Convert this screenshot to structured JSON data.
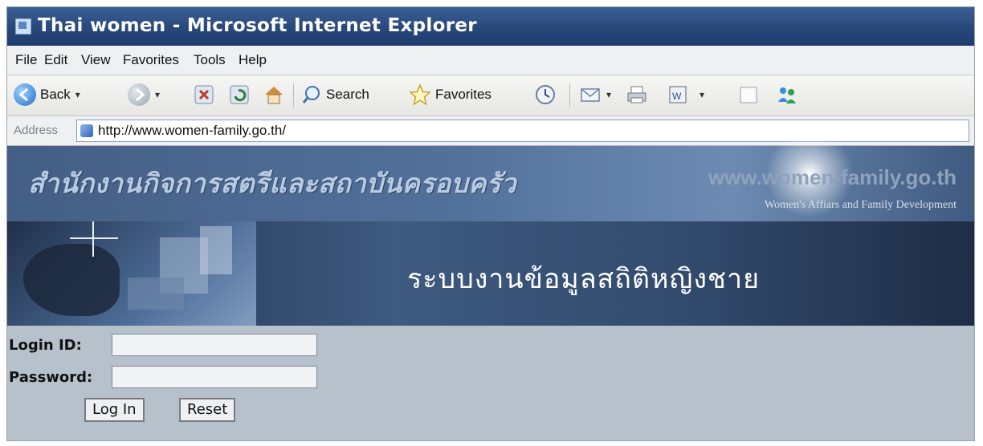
{
  "window": {
    "title": "Thai women - Microsoft Internet Explorer"
  },
  "menu": {
    "items": [
      "File",
      "Edit",
      "View",
      "Favorites",
      "Tools",
      "Help"
    ]
  },
  "toolbar": {
    "back_label": "Back",
    "search_label": "Search",
    "favorites_label": "Favorites"
  },
  "address": {
    "label": "Address",
    "url": "http://www.women-family.go.th/"
  },
  "banner": {
    "thai_title": "สำนักงานกิจการสตรีและสถาบันครอบครัว",
    "site_url": "www.women-family.go.th",
    "site_subtitle": "Women's Affiars and Family Development",
    "system_title": "ระบบงานข้อมูลสถิติหญิงชาย"
  },
  "form": {
    "login_label": "Login ID:",
    "password_label": "Password:",
    "login_value": "",
    "password_value": "",
    "login_button": "Log In",
    "reset_button": "Reset"
  },
  "colors": {
    "titlebar": "#27467a",
    "banner": "#51709a",
    "form_bg": "#b7c1cc"
  },
  "icons": [
    "back-icon",
    "forward-icon",
    "stop-icon",
    "refresh-icon",
    "home-icon",
    "search-icon",
    "favorites-star-icon",
    "history-icon",
    "mail-icon",
    "print-icon",
    "edit-icon",
    "discuss-icon",
    "messenger-icon",
    "page-icon"
  ]
}
